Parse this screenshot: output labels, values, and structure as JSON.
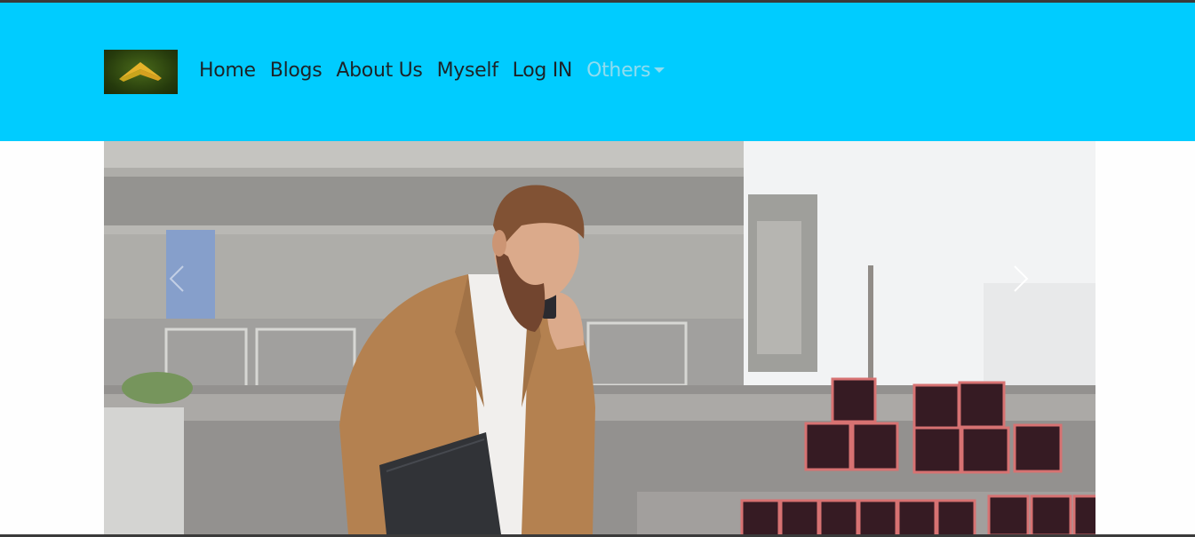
{
  "navbar": {
    "background": "#00ccff",
    "brand_icon": "house-roof-logo",
    "links": [
      {
        "label": "Home"
      },
      {
        "label": "Blogs"
      },
      {
        "label": "About Us"
      },
      {
        "label": "Myself"
      },
      {
        "label": "Log IN"
      }
    ],
    "dropdown": {
      "label": "Others",
      "icon": "caret-down-icon"
    }
  },
  "carousel": {
    "image_icon": "hero-photo",
    "prev_icon": "chevron-left-icon",
    "next_icon": "chevron-right-icon"
  }
}
